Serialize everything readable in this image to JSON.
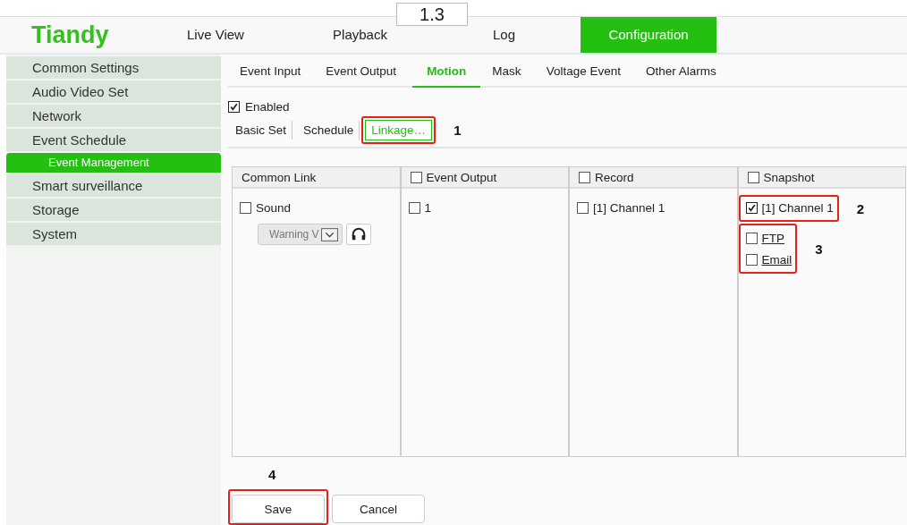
{
  "version_label": "1.3",
  "header": {
    "logo": "Tiandy",
    "nav": [
      {
        "label": "Live View",
        "selected": false
      },
      {
        "label": "Playback",
        "selected": false
      },
      {
        "label": "Log",
        "selected": false
      },
      {
        "label": "Configuration",
        "selected": true
      }
    ]
  },
  "sidebar": {
    "items": [
      {
        "label": "Common Settings",
        "selected": false
      },
      {
        "label": "Audio Video Set",
        "selected": false
      },
      {
        "label": "Network",
        "selected": false
      },
      {
        "label": "Event Schedule",
        "selected": false,
        "children": [
          {
            "label": "Event Management",
            "selected": true
          }
        ]
      },
      {
        "label": "Smart surveillance",
        "selected": false
      },
      {
        "label": "Storage",
        "selected": false
      },
      {
        "label": "System",
        "selected": false
      }
    ]
  },
  "tabs": [
    {
      "label": "Event Input",
      "selected": false
    },
    {
      "label": "Event Output",
      "selected": false
    },
    {
      "label": "Motion",
      "selected": true
    },
    {
      "label": "Mask",
      "selected": false
    },
    {
      "label": "Voltage Event",
      "selected": false
    },
    {
      "label": "Other Alarms",
      "selected": false
    }
  ],
  "enabled": {
    "label": "Enabled",
    "checked": true
  },
  "breadcrumb": [
    {
      "label": "Basic Set",
      "selected": false
    },
    {
      "label": "Schedule",
      "selected": false
    },
    {
      "label": "Linkage…",
      "selected": true,
      "callout": "1"
    }
  ],
  "columns": [
    {
      "header": "Common Link",
      "groups": [
        {
          "items": [
            {
              "label": "Sound",
              "checked": false,
              "kind": "check"
            }
          ],
          "sound_select": "Warning V"
        }
      ]
    },
    {
      "header": "Event Output",
      "checked": false,
      "groups": [
        {
          "items": [
            {
              "label": "1",
              "checked": false,
              "kind": "check"
            }
          ]
        }
      ]
    },
    {
      "header": "Record",
      "checked": false,
      "groups": [
        {
          "items": [
            {
              "label": "[1] Channel 1",
              "checked": false,
              "kind": "check"
            }
          ]
        }
      ]
    },
    {
      "header": "Snapshot",
      "checked": false,
      "groups": [
        {
          "callout": "2",
          "items": [
            {
              "label": "[1] Channel 1",
              "checked": true,
              "kind": "check"
            }
          ]
        },
        {
          "callout": "3",
          "items": [
            {
              "label": "FTP",
              "checked": false,
              "kind": "link"
            },
            {
              "label": "Email",
              "checked": false,
              "kind": "link"
            }
          ]
        }
      ]
    }
  ],
  "buttons": [
    {
      "label": "Save",
      "callout": "4"
    },
    {
      "label": "Cancel"
    }
  ]
}
